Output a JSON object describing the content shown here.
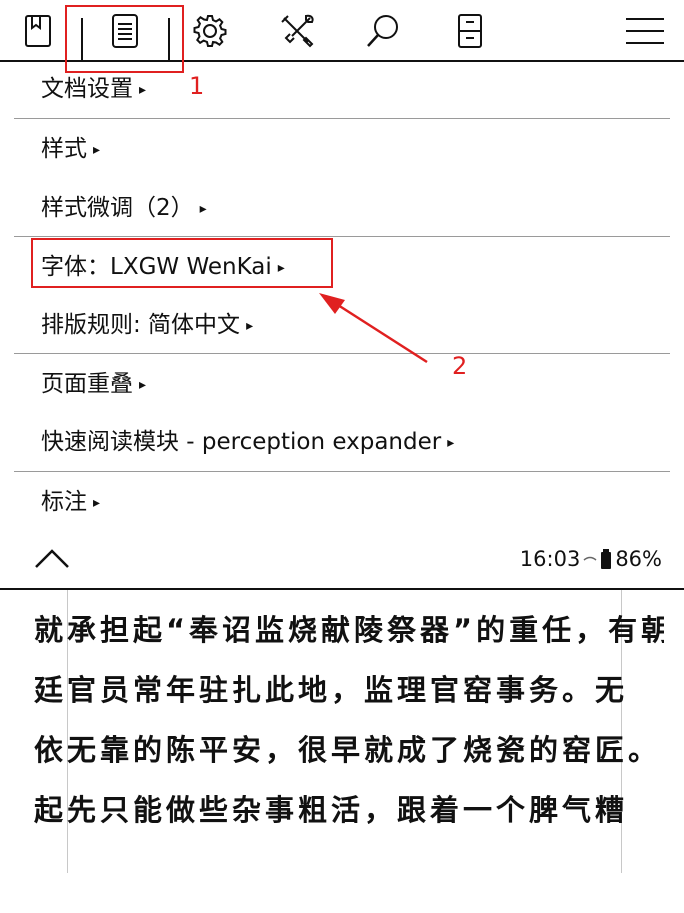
{
  "toolbar": {
    "icons": [
      "bookmark-icon",
      "document-icon",
      "gear-icon",
      "tools-icon",
      "search-icon",
      "device-icon",
      "menu-icon"
    ],
    "selected_index": 1
  },
  "menu": {
    "items": [
      {
        "label": "文档设置",
        "arrow": "▸"
      },
      {
        "label": "样式",
        "arrow": "▸"
      },
      {
        "label": "样式微调（2）",
        "arrow": "▸"
      },
      {
        "label": "字体：LXGW WenKai",
        "arrow": "▸"
      },
      {
        "label": "排版规则: 简体中文",
        "arrow": "▸"
      },
      {
        "label": "页面重叠",
        "arrow": "▸"
      },
      {
        "label": "快速阅读模块 - perception expander",
        "arrow": "▸"
      },
      {
        "label": "标注",
        "arrow": "▸"
      }
    ]
  },
  "annotations": {
    "marker_1": "1",
    "marker_2": "2",
    "color": "#e02020"
  },
  "status": {
    "time": "16:03",
    "battery": "86%"
  },
  "reader": {
    "lines": [
      "就承担起“奉诏监烧献陵祭器”的重任，有朝",
      "廷官员常年驻扎此地，监理官窑事务。无",
      "依无靠的陈平安，很早就成了烧瓷的窑匠。",
      "起先只能做些杂事粗活，跟着一个脾气糟"
    ]
  }
}
